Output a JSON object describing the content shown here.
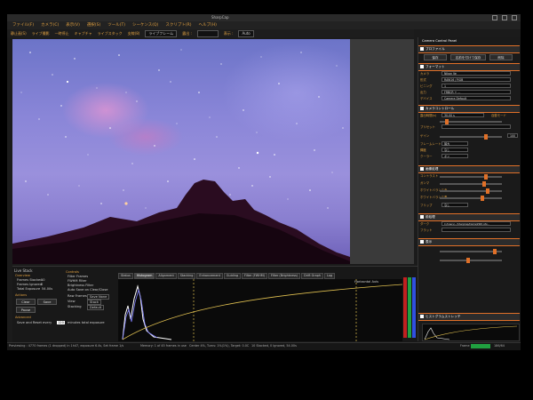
{
  "window": {
    "title": "SharpCap"
  },
  "menu": [
    {
      "label": "ファイル(F)"
    },
    {
      "label": "カメラ(C)"
    },
    {
      "label": "表示(V)"
    },
    {
      "label": "選択(S)"
    },
    {
      "label": "ツール(T)"
    },
    {
      "label": "シーケンス(Q)"
    },
    {
      "label": "スクリプト(R)"
    },
    {
      "label": "ヘルプ(H)"
    }
  ],
  "toolbar": {
    "items": [
      "静止画(S)",
      "ライブ撮影",
      "一時停止",
      "キャプチャ",
      "ライブスタック",
      "支線(8)",
      "ライブフレーム",
      "露出 :",
      "表示 :",
      "Auto"
    ],
    "zoom_value": "Auto"
  },
  "live_stack": {
    "title": "Live Stack",
    "overview_label": "Overview",
    "frames_stacked_label": "Frames Stacked",
    "frames_stacked": "10",
    "frames_ignored_label": "Frames Ignored",
    "frames_ignored": "0",
    "total_exposure_label": "Total Exposure",
    "total_exposure": "54.00s",
    "actions_label": "Actions",
    "clear_button": "Clear",
    "save_button": "Save",
    "pause_button": "Pause",
    "advanced_label": "Advanced",
    "save_reset_label": "Save and Reset every",
    "save_reset_value": "120",
    "save_reset_suffix": "minutes total exposure",
    "controls_label": "Controls",
    "filter_frames": "Filter Frames",
    "fwhm_filter": "FWHM Filter",
    "brightness_filter": "Brightness Filter",
    "auto_save": "Auto Save on Clear/Close",
    "raw_frames_label": "Raw Frames",
    "raw_frames_value": "Save None",
    "view_label": "View",
    "view_value": "Stack",
    "stacking_label": "Stacking",
    "stacking_value": "Default",
    "tabs": [
      "Status",
      "Histogram",
      "Alignment",
      "Stacking",
      "Enhancement",
      "Guiding",
      "Filter (FWHM)",
      "Filter (Brightness)",
      "Drift Graph",
      "Log"
    ],
    "active_tab": "Histogram",
    "graph_note": "Horizontal Axis"
  },
  "status_bar": {
    "left": "Previewing : 4770 frames (1 dropped) in 1h47, exposure 6.4s, Set frame 1/s",
    "middle": "Memory: 1 of 45 frames in use",
    "center": "Center 4%, Turns: 1%(1%), Target: 0.0C",
    "right": "10 Stacked, 0 Ignored, 54.00s",
    "frame_label": "Frame",
    "frame_value": "186/64"
  },
  "camera_panel": {
    "title": "Camera Control Panel",
    "profile_section": "プロファイル",
    "profile_buttons": [
      "保存",
      "名前を付けて保存",
      "削除"
    ],
    "format_section": "フォーマット",
    "camera_label": "カメラ",
    "camera_value": "Nikon Ve",
    "file_label": "形式",
    "file_value": "RAW16 / RGB",
    "binning_label": "ビニング",
    "binning_value": "1",
    "output_label": "出力",
    "output_value": "FRBCR + ...",
    "device_label": "デバイス",
    "device_value": "Camera Default",
    "control_section": "カメラコントロール",
    "exposure_label": "露出時間(s)",
    "exposure_value": "30.00 s",
    "auto_label": "自動モード",
    "preset_label": "プリセット",
    "gain_label": "ゲイン",
    "gain_value": "100",
    "framerate_label": "フレームレート",
    "framerate_value": "最大",
    "brightness_label": "輝度",
    "brightness_value": "なし",
    "cooler_label": "クーラー",
    "cooler_value": "オン",
    "image_section": "画像処理",
    "contrast_label": "コントラスト",
    "gamma_label": "ガンマ",
    "wb_red_label": "ホワイトバランス赤",
    "wb_blue_label": "ホワイトバランス青",
    "color_space_label": "色空間",
    "flip_label": "フリップ",
    "flip_value": "なし",
    "preprocess_section": "前処理",
    "dark_label": "ダーク",
    "dark_value": "C:/Users/.../SharpCap/Darks/ZWO ASI...",
    "flat_label": "フラット",
    "display_section": "表示",
    "histogram_section": "ヒストグラムストレッチ",
    "save_section": "保存設定",
    "reset_section": "初期設定"
  }
}
